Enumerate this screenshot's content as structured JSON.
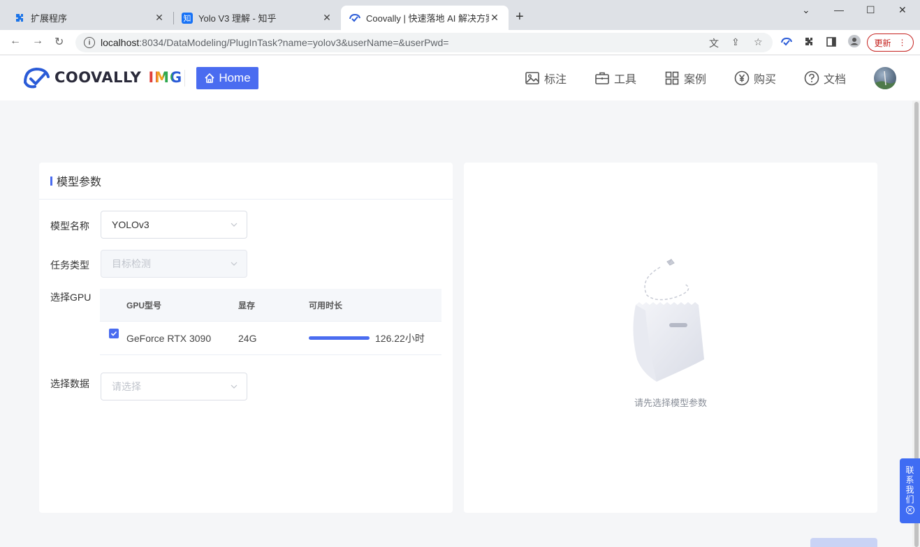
{
  "browser": {
    "tabs": [
      {
        "title": "扩展程序",
        "icon": "puzzle-icon"
      },
      {
        "title": "Yolo V3 理解 - 知乎",
        "icon": "zhihu-icon",
        "icon_text": "知"
      },
      {
        "title": "Coovally | 快速落地 AI 解决方案",
        "icon": "coovally-icon"
      }
    ],
    "url_host": "localhost",
    "url_path": ":8034/DataModeling/PlugInTask?name=yolov3&userName=&userPwd=",
    "update_label": "更新"
  },
  "header": {
    "logo_text": "COOVALLY",
    "logo_sub": "IMG",
    "home_label": "Home",
    "nav": [
      {
        "label": "标注",
        "icon": "image-annotate-icon"
      },
      {
        "label": "工具",
        "icon": "toolbox-icon"
      },
      {
        "label": "案例",
        "icon": "grid-icon"
      },
      {
        "label": "购买",
        "icon": "yen-icon"
      },
      {
        "label": "文档",
        "icon": "help-icon"
      }
    ]
  },
  "form": {
    "title": "模型参数",
    "model_name_label": "模型名称",
    "model_name_value": "YOLOv3",
    "task_type_label": "任务类型",
    "task_type_value": "目标检测",
    "gpu_label": "选择GPU",
    "gpu_columns": [
      "GPU型号",
      "显存",
      "可用时长"
    ],
    "gpu_rows": [
      {
        "model": "GeForce RTX 3090",
        "memory": "24G",
        "duration": "126.22小时",
        "checked": true,
        "fill": 1.0
      }
    ],
    "data_label": "选择数据",
    "data_placeholder": "请选择"
  },
  "preview": {
    "empty_text": "请先选择模型参数"
  },
  "contact": {
    "label_chars": [
      "联",
      "系",
      "我",
      "们"
    ]
  },
  "colors": {
    "accent": "#4a6cf0",
    "contact": "#3f6cf3"
  }
}
